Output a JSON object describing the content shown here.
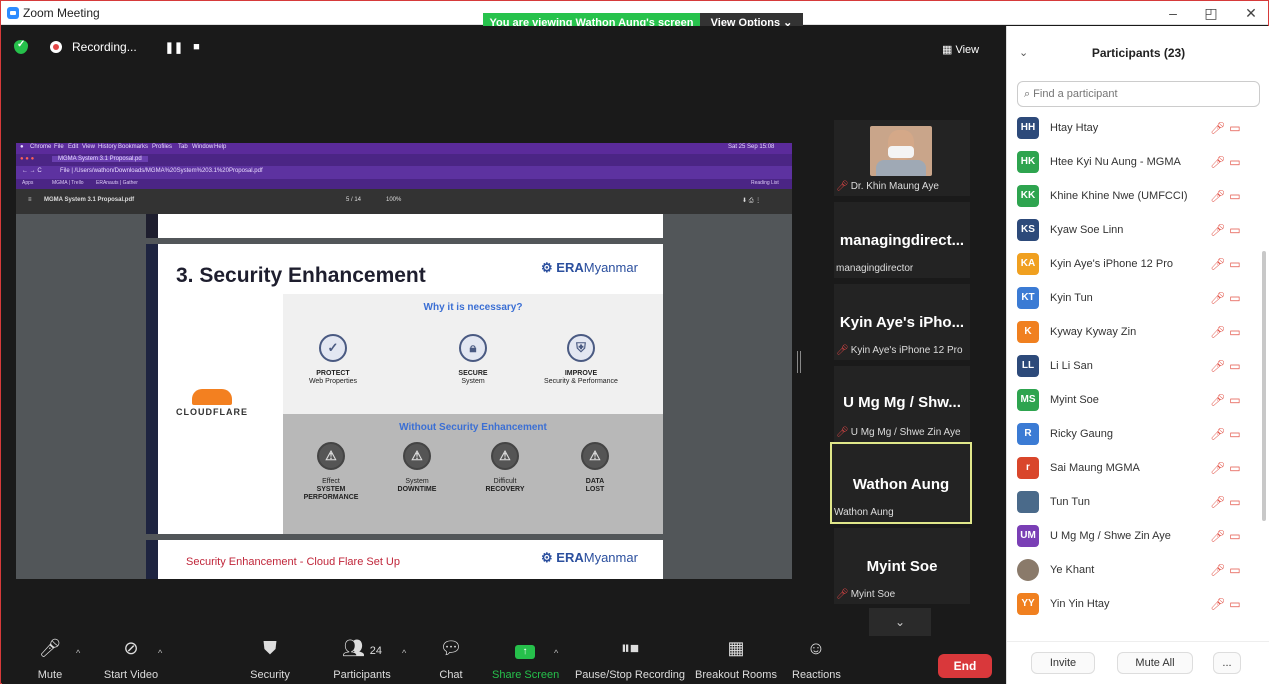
{
  "window": {
    "title": "Zoom Meeting",
    "viewing_banner": "You are viewing Wathon Aung's screen",
    "view_options": "View Options ⌄",
    "minimize": "–",
    "maximize": "◰",
    "close": "✕"
  },
  "recording": {
    "label": "Recording...",
    "pause": "❚❚",
    "stop": "■"
  },
  "view_button": "▦ View",
  "shared_screen": {
    "mac_menu": [
      "Chrome",
      "File",
      "Edit",
      "View",
      "History",
      "Bookmarks",
      "Profiles",
      "Tab",
      "Window",
      "Help"
    ],
    "mac_clock": "Sat 25 Sep 15:08",
    "tab_title": "MGMA System 3.1 Proposal.pd",
    "address": "File | /Users/wathon/Downloads/MGMA%20System%203.1%20Proposal.pdf",
    "bookmarks": [
      "Apps",
      "MGMA | Trello",
      "ERAnauts | Gather"
    ],
    "reading_list": "Reading List",
    "pdf_name": "MGMA System 3.1 Proposal.pdf",
    "page_indicator": "5 / 14",
    "zoom": "100%",
    "slide": {
      "title": "3. Security Enhancement",
      "logo_bold": "ERA",
      "logo_thin": "Myanmar",
      "brand": "CLOUDFLARE",
      "why_heading": "Why it is necessary?",
      "benefits": [
        {
          "label": "PROTECT",
          "sub": "Web Properties",
          "icon": "shield-icon"
        },
        {
          "label": "SECURE",
          "sub": "System",
          "icon": "lock-icon"
        },
        {
          "label": "IMPROVE",
          "sub": "Security & Performance",
          "icon": "shield-badge-icon"
        }
      ],
      "without_heading": "Without Security Enhancement",
      "risks": [
        {
          "line1": "Effect",
          "line2": "SYSTEM",
          "line3": "PERFORMANCE"
        },
        {
          "line1": "System",
          "line2": "DOWNTIME",
          "line3": ""
        },
        {
          "line1": "Difficult",
          "line2": "RECOVERY",
          "line3": ""
        },
        {
          "line1": "DATA",
          "line2": "LOST",
          "line3": ""
        }
      ]
    },
    "slide2": {
      "title": "Security Enhancement - Cloud Flare Set Up",
      "logo_bold": "ERA",
      "logo_thin": "Myanmar"
    }
  },
  "tiles": [
    {
      "big": "",
      "small": "Dr. Khin Maung Aye",
      "muted": true,
      "photo": true
    },
    {
      "big": "managingdirect...",
      "small": "managingdirector",
      "muted": false,
      "photo": false
    },
    {
      "big": "Kyin Aye's iPho...",
      "small": "Kyin Aye's iPhone 12 Pro",
      "muted": true,
      "photo": false
    },
    {
      "big": "U Mg Mg / Shw...",
      "small": "U Mg Mg / Shwe Zin Aye",
      "muted": true,
      "photo": false
    },
    {
      "big": "Wathon Aung",
      "small": "Wathon Aung",
      "muted": false,
      "photo": false,
      "active": true
    },
    {
      "big": "Myint Soe",
      "small": "Myint Soe",
      "muted": true,
      "photo": false
    }
  ],
  "toolbar": {
    "mute": "Mute",
    "start_video": "Start Video",
    "security": "Security",
    "participants": "Participants",
    "participants_count": "24",
    "chat": "Chat",
    "share_screen": "Share Screen",
    "pause_stop_recording": "Pause/Stop Recording",
    "breakout_rooms": "Breakout Rooms",
    "reactions": "Reactions",
    "end": "End"
  },
  "panel": {
    "title": "Participants (23)",
    "search_placeholder": "Find a participant",
    "participants": [
      {
        "initials": "HH",
        "name": "Htay Htay",
        "color": "#2d4a7a"
      },
      {
        "initials": "HK",
        "name": "Htee Kyi Nu Aung - MGMA",
        "color": "#2ea44f"
      },
      {
        "initials": "KK",
        "name": "Khine Khine Nwe (UMFCCI)",
        "color": "#2ea44f"
      },
      {
        "initials": "KS",
        "name": "Kyaw Soe Linn",
        "color": "#2d4a7a"
      },
      {
        "initials": "KA",
        "name": "Kyin Aye's iPhone 12 Pro",
        "color": "#f0a020"
      },
      {
        "initials": "KT",
        "name": "Kyin Tun",
        "color": "#3b7bd4"
      },
      {
        "initials": "K",
        "name": "Kyway Kyway Zin",
        "color": "#f08020"
      },
      {
        "initials": "LL",
        "name": "Li Li San",
        "color": "#2d4a7a"
      },
      {
        "initials": "MS",
        "name": "Myint Soe",
        "color": "#2ea44f"
      },
      {
        "initials": "R",
        "name": "Ricky Gaung",
        "color": "#3b7bd4"
      },
      {
        "initials": "r",
        "name": "Sai Maung MGMA",
        "color": "#d9462b"
      },
      {
        "initials": "",
        "name": "Tun Tun",
        "color": "#4a6a8a"
      },
      {
        "initials": "UM",
        "name": "U Mg Mg / Shwe Zin Aye",
        "color": "#7a3fb5"
      },
      {
        "initials": "",
        "name": "Ye Khant",
        "color": "#8a7a6a"
      },
      {
        "initials": "YY",
        "name": "Yin Yin Htay",
        "color": "#f08020"
      }
    ],
    "invite": "Invite",
    "mute_all": "Mute All",
    "more": "..."
  }
}
